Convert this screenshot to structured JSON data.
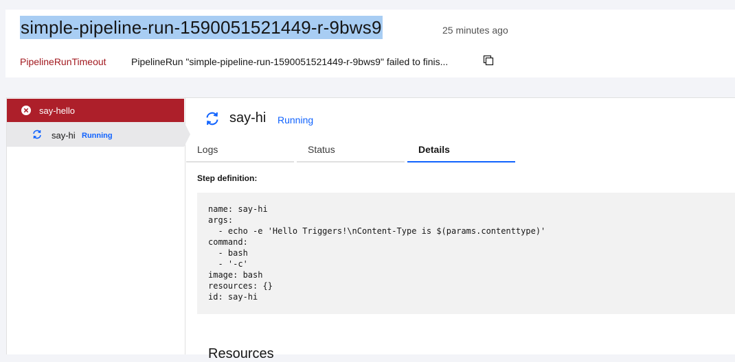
{
  "header": {
    "title": "simple-pipeline-run-1590051521449-r-9bws9",
    "time_ago": "25 minutes ago",
    "status_reason": "PipelineRunTimeout",
    "status_message": "PipelineRun \"simple-pipeline-run-1590051521449-r-9bws9\" failed to finis...",
    "copy_icon": "copy-icon"
  },
  "sidebar": {
    "task": {
      "label": "say-hello",
      "icon": "error-icon",
      "color": "#ad1f2a"
    },
    "step": {
      "label": "say-hi",
      "status": "Running",
      "icon": "in-progress-icon"
    }
  },
  "details": {
    "step_name": "say-hi",
    "step_status": "Running",
    "tabs": [
      {
        "label": "Logs",
        "active": false
      },
      {
        "label": "Status",
        "active": false
      },
      {
        "label": "Details",
        "active": true
      }
    ],
    "section_label": "Step definition:",
    "definition": "name: say-hi\nargs:\n  - echo -e 'Hello Triggers!\\nContent-Type is $(params.contenttype)'\ncommand:\n  - bash\n  - '-c'\nimage: bash\nresources: {}\nid: say-hi",
    "next_section_heading": "Resources"
  },
  "colors": {
    "accent": "#0f62fe",
    "error": "#a2191f",
    "selection_highlight": "#a8cdf3"
  }
}
